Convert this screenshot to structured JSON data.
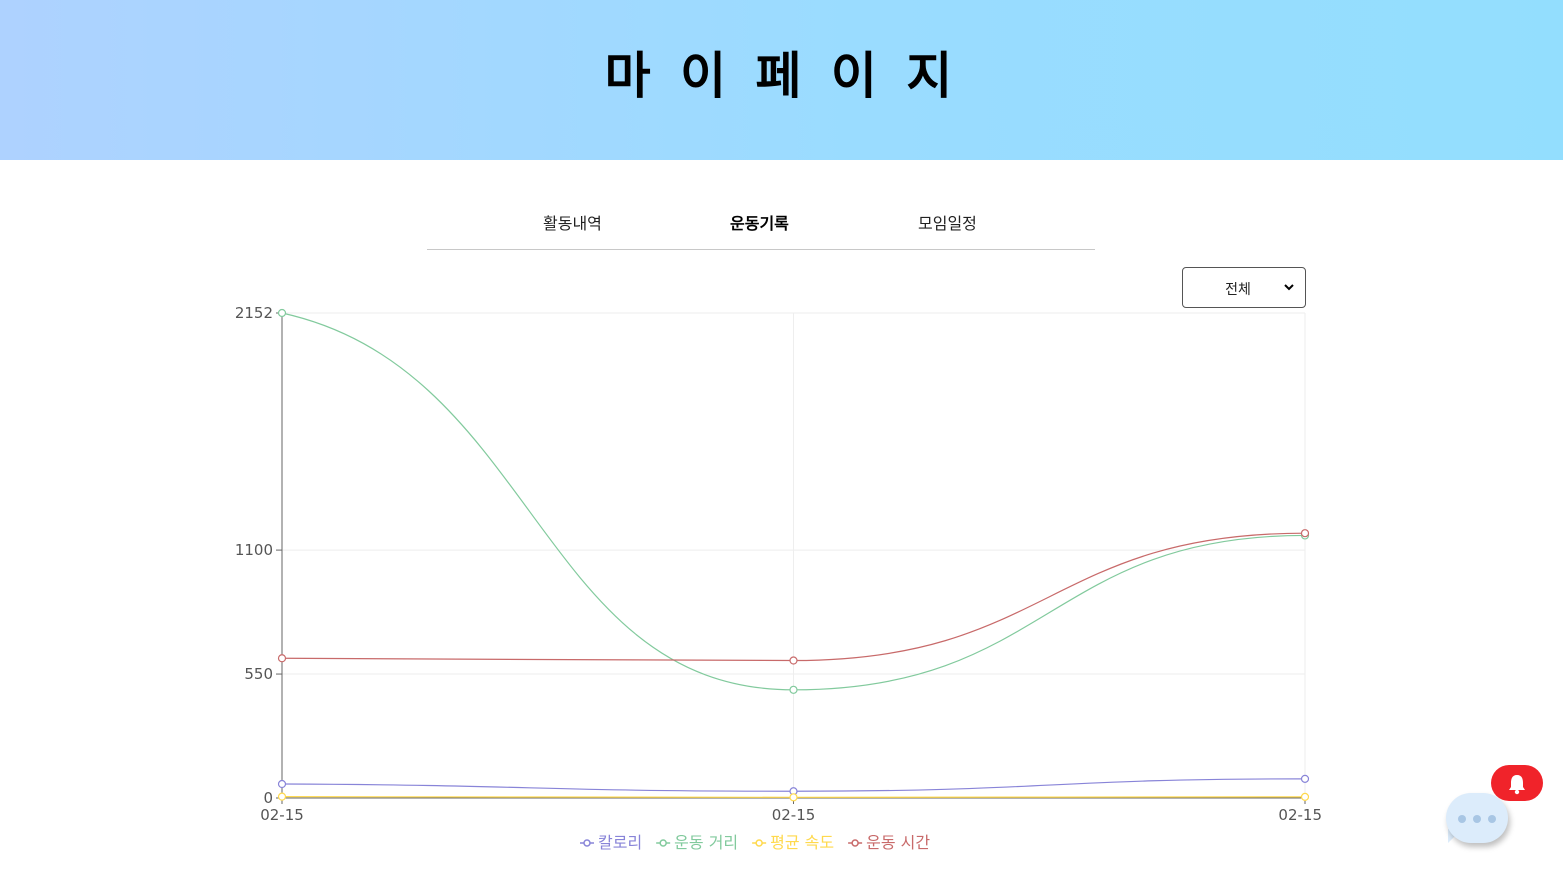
{
  "header": {
    "title": "마 이 페 이 지"
  },
  "tabs": [
    {
      "label": "활동내역",
      "active": false
    },
    {
      "label": "운동기록",
      "active": true
    },
    {
      "label": "모임일정",
      "active": false
    }
  ],
  "filter": {
    "selected": "전체"
  },
  "chart_data": {
    "type": "line",
    "categories": [
      "02-15",
      "02-15",
      "02-15"
    ],
    "y_ticks": [
      "0",
      "550",
      "1100",
      "2152"
    ],
    "ylim": [
      0,
      2152
    ],
    "grid": true,
    "legend_position": "bottom",
    "series": [
      {
        "name": "칼로리",
        "color": "#8884d8",
        "values": [
          62,
          30,
          85
        ]
      },
      {
        "name": "운동 거리",
        "color": "#82ca9d",
        "values": [
          2152,
          480,
          1165
        ]
      },
      {
        "name": "평균 속도",
        "color": "#ffd94d",
        "values": [
          6,
          3,
          5
        ]
      },
      {
        "name": "운동 시간",
        "color": "#c86a6a",
        "values": [
          620,
          610,
          1175
        ]
      }
    ]
  },
  "icons": {
    "chat": "chat-bubble-icon",
    "bell": "bell-icon"
  }
}
